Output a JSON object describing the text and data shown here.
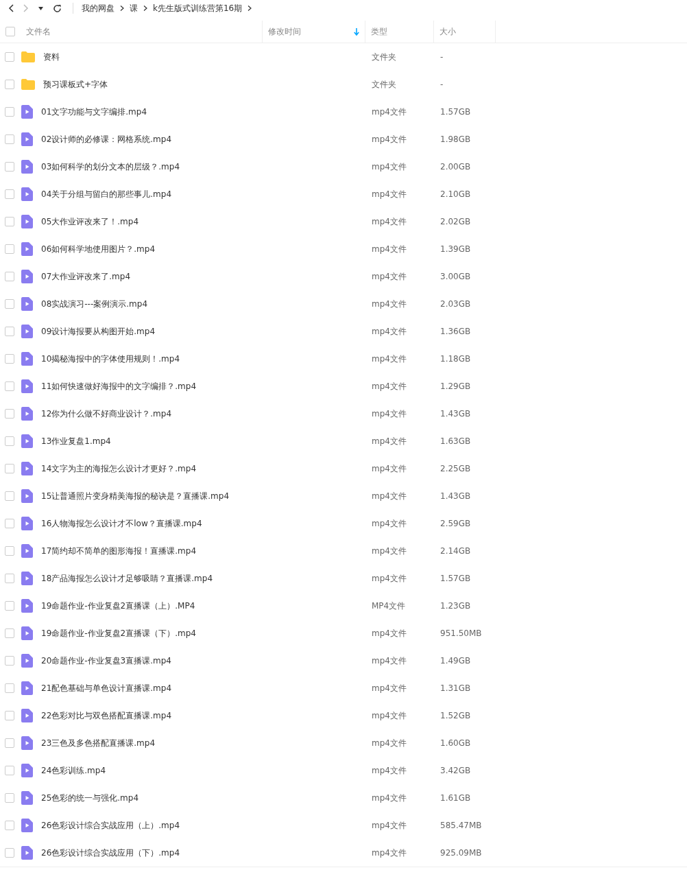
{
  "breadcrumb": [
    "我的网盘",
    "课",
    "k先生版式训练营第16期"
  ],
  "table": {
    "select_all": {
      "checked": false
    },
    "columns": [
      {
        "label": "文件名",
        "sorted": false
      },
      {
        "label": "修改时间",
        "sorted": true
      },
      {
        "label": "类型",
        "sorted": false
      },
      {
        "label": "大小",
        "sorted": false
      }
    ],
    "rows": [
      {
        "kind": "folder",
        "name": "资料",
        "type": "文件夹",
        "size": "-",
        "checked": false
      },
      {
        "kind": "folder",
        "name": "预习课板式+字体",
        "type": "文件夹",
        "size": "-",
        "checked": false
      },
      {
        "kind": "video",
        "name": "01文字功能与文字编排.mp4",
        "type": "mp4文件",
        "size": "1.57GB",
        "checked": false
      },
      {
        "kind": "video",
        "name": "02设计师的必修课：网格系统.mp4",
        "type": "mp4文件",
        "size": "1.98GB",
        "checked": false
      },
      {
        "kind": "video",
        "name": "03如何科学的划分文本的层级？.mp4",
        "type": "mp4文件",
        "size": "2.00GB",
        "checked": false
      },
      {
        "kind": "video",
        "name": "04关于分组与留白的那些事儿.mp4",
        "type": "mp4文件",
        "size": "2.10GB",
        "checked": false
      },
      {
        "kind": "video",
        "name": "05大作业评改来了！.mp4",
        "type": "mp4文件",
        "size": "2.02GB",
        "checked": false
      },
      {
        "kind": "video",
        "name": "06如何科学地使用图片？.mp4",
        "type": "mp4文件",
        "size": "1.39GB",
        "checked": false
      },
      {
        "kind": "video",
        "name": "07大作业评改来了.mp4",
        "type": "mp4文件",
        "size": "3.00GB",
        "checked": false
      },
      {
        "kind": "video",
        "name": "08实战演习---案例演示.mp4",
        "type": "mp4文件",
        "size": "2.03GB",
        "checked": false
      },
      {
        "kind": "video",
        "name": "09设计海报要从构图开始.mp4",
        "type": "mp4文件",
        "size": "1.36GB",
        "checked": false
      },
      {
        "kind": "video",
        "name": "10揭秘海报中的字体使用规则！.mp4",
        "type": "mp4文件",
        "size": "1.18GB",
        "checked": false
      },
      {
        "kind": "video",
        "name": "11如何快速做好海报中的文字编排？.mp4",
        "type": "mp4文件",
        "size": "1.29GB",
        "checked": false
      },
      {
        "kind": "video",
        "name": "12你为什么做不好商业设计？.mp4",
        "type": "mp4文件",
        "size": "1.43GB",
        "checked": false
      },
      {
        "kind": "video",
        "name": "13作业复盘1.mp4",
        "type": "mp4文件",
        "size": "1.63GB",
        "checked": false
      },
      {
        "kind": "video",
        "name": "14文字为主的海报怎么设计才更好？.mp4",
        "type": "mp4文件",
        "size": "2.25GB",
        "checked": false
      },
      {
        "kind": "video",
        "name": "15让普通照片变身精美海报的秘诀是？直播课.mp4",
        "type": "mp4文件",
        "size": "1.43GB",
        "checked": false
      },
      {
        "kind": "video",
        "name": "16人物海报怎么设计才不low？直播课.mp4",
        "type": "mp4文件",
        "size": "2.59GB",
        "checked": false
      },
      {
        "kind": "video",
        "name": "17简约却不简单的图形海报！直播课.mp4",
        "type": "mp4文件",
        "size": "2.14GB",
        "checked": false
      },
      {
        "kind": "video",
        "name": "18产品海报怎么设计才足够吸睛？直播课.mp4",
        "type": "mp4文件",
        "size": "1.57GB",
        "checked": false
      },
      {
        "kind": "video",
        "name": "19命题作业-作业复盘2直播课（上）.MP4",
        "type": "MP4文件",
        "size": "1.23GB",
        "checked": false
      },
      {
        "kind": "video",
        "name": "19命题作业-作业复盘2直播课（下）.mp4",
        "type": "mp4文件",
        "size": "951.50MB",
        "checked": false
      },
      {
        "kind": "video",
        "name": "20命题作业-作业复盘3直播课.mp4",
        "type": "mp4文件",
        "size": "1.49GB",
        "checked": false
      },
      {
        "kind": "video",
        "name": "21配色基础与单色设计直播课.mp4",
        "type": "mp4文件",
        "size": "1.31GB",
        "checked": false
      },
      {
        "kind": "video",
        "name": "22色彩对比与双色搭配直播课.mp4",
        "type": "mp4文件",
        "size": "1.52GB",
        "checked": false
      },
      {
        "kind": "video",
        "name": "23三色及多色搭配直播课.mp4",
        "type": "mp4文件",
        "size": "1.60GB",
        "checked": false
      },
      {
        "kind": "video",
        "name": "24色彩训练.mp4",
        "type": "mp4文件",
        "size": "3.42GB",
        "checked": false
      },
      {
        "kind": "video",
        "name": "25色彩的统一与强化.mp4",
        "type": "mp4文件",
        "size": "1.61GB",
        "checked": false
      },
      {
        "kind": "video",
        "name": "26色彩设计综合实战应用（上）.mp4",
        "type": "mp4文件",
        "size": "585.47MB",
        "checked": false
      },
      {
        "kind": "video",
        "name": "26色彩设计综合实战应用（下）.mp4",
        "type": "mp4文件",
        "size": "925.09MB",
        "checked": false
      }
    ]
  }
}
